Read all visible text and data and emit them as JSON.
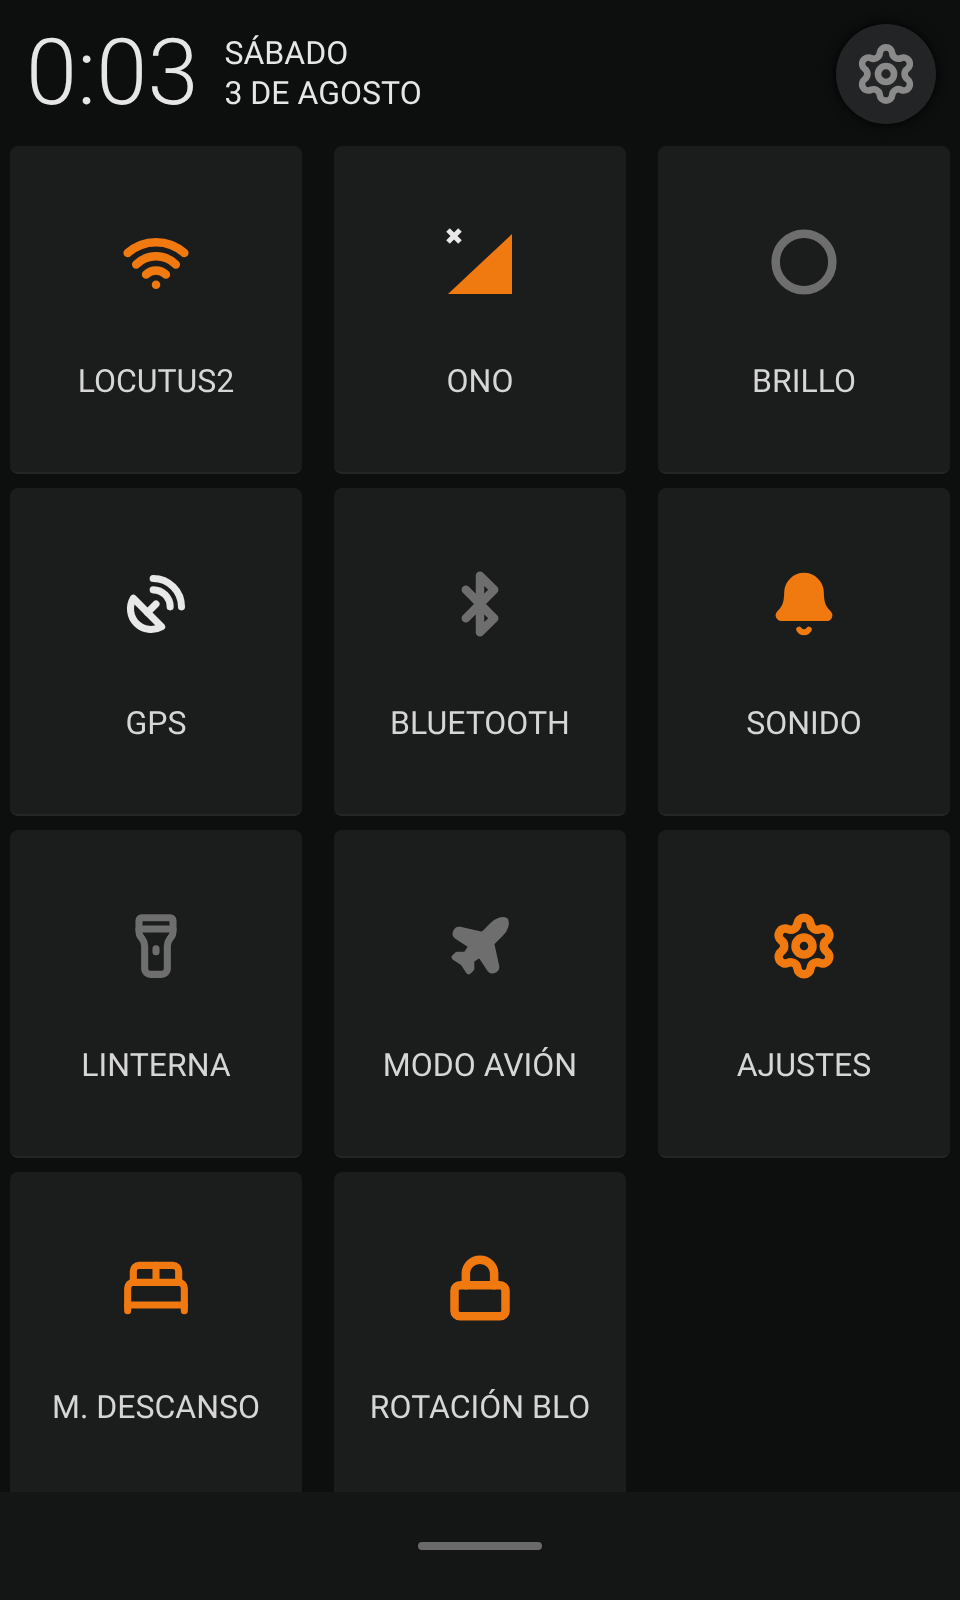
{
  "header": {
    "time": "0:03",
    "day": "SÁBADO",
    "date": "3 DE AGOSTO"
  },
  "tiles": [
    {
      "kind": "wifi",
      "label": "LOCUTUS2",
      "color": "#f07a10"
    },
    {
      "kind": "signal",
      "label": "ONO",
      "color": "#f07a10"
    },
    {
      "kind": "brightness",
      "label": "BRILLO",
      "color": "#6e6e6e"
    },
    {
      "kind": "gps",
      "label": "GPS",
      "color": "#e8e8e8"
    },
    {
      "kind": "bluetooth",
      "label": "BLUETOOTH",
      "color": "#6e6e6e"
    },
    {
      "kind": "sound",
      "label": "SONIDO",
      "color": "#f07a10"
    },
    {
      "kind": "flashlight",
      "label": "LINTERNA",
      "color": "#6e6e6e"
    },
    {
      "kind": "airplane",
      "label": "MODO AVIÓN",
      "color": "#6e6e6e"
    },
    {
      "kind": "settings",
      "label": "AJUSTES",
      "color": "#f07a10"
    },
    {
      "kind": "sleep",
      "label": "M. DESCANSO",
      "color": "#f07a10"
    },
    {
      "kind": "rotation",
      "label": "ROTACIÓN BLO",
      "color": "#f07a10"
    }
  ]
}
